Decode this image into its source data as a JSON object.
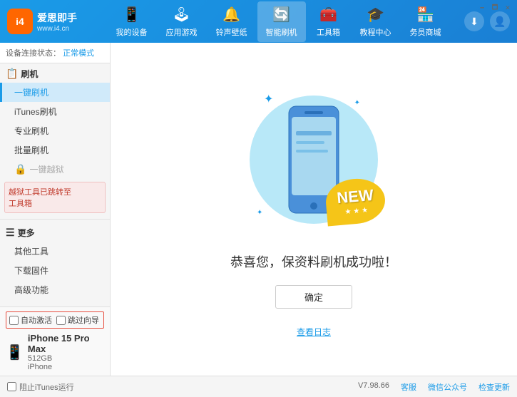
{
  "app": {
    "logo_icon": "i4",
    "logo_title": "爱思即手",
    "logo_sub": "www.i4.cn",
    "win_min": "—",
    "win_max": "□",
    "win_close": "✕"
  },
  "nav": {
    "items": [
      {
        "id": "my-device",
        "icon": "📱",
        "label": "我的设备"
      },
      {
        "id": "apps-games",
        "icon": "👤",
        "label": "应用游戏"
      },
      {
        "id": "ringtones",
        "icon": "🔔",
        "label": "铃声壁纸"
      },
      {
        "id": "smart-flash",
        "icon": "🔄",
        "label": "智能刷机",
        "active": true
      },
      {
        "id": "toolbox",
        "icon": "🧰",
        "label": "工具箱"
      },
      {
        "id": "tutorial",
        "icon": "🎓",
        "label": "教程中心"
      },
      {
        "id": "business",
        "icon": "🏪",
        "label": "务员商城"
      }
    ],
    "download_icon": "⬇",
    "user_icon": "👤"
  },
  "sidebar": {
    "status_label": "设备连接状态：",
    "status_mode": "正常模式",
    "flash_group": "刷机",
    "items": [
      {
        "id": "one-key-flash",
        "label": "一键刷机",
        "active": true
      },
      {
        "id": "itunes-flash",
        "label": "iTunes刷机"
      },
      {
        "id": "pro-flash",
        "label": "专业刷机"
      },
      {
        "id": "batch-flash",
        "label": "批量刷机"
      }
    ],
    "disabled_item": "一键越狱",
    "notice": "越狱工具已跳转至\n工具箱",
    "more_group": "更多",
    "more_items": [
      {
        "id": "other-tools",
        "label": "其他工具"
      },
      {
        "id": "download-firmware",
        "label": "下载固件"
      },
      {
        "id": "advanced",
        "label": "高级功能"
      }
    ]
  },
  "content": {
    "new_badge": "NEW",
    "success_msg": "恭喜您，保资料刷机成功啦！",
    "confirm_btn": "确定",
    "view_log": "查看日志"
  },
  "device": {
    "auto_activate": "自动激活",
    "guided_setup": "跳过向导",
    "name": "iPhone 15 Pro Max",
    "storage": "512GB",
    "type": "iPhone"
  },
  "footer": {
    "stop_itunes": "阻止iTunes运行",
    "version": "V7.98.66",
    "skin": "客服",
    "wechat": "微信公众号",
    "check_update": "检查更新"
  }
}
